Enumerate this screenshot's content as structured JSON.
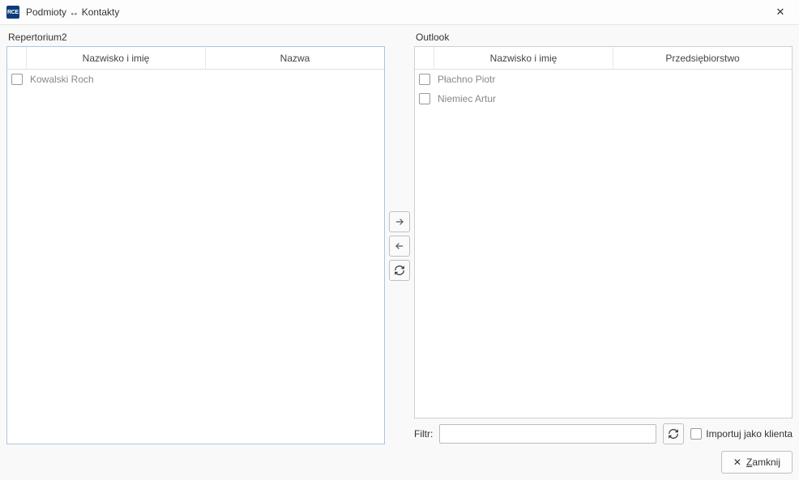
{
  "window": {
    "app_icon_text": "RCE",
    "title": "Podmioty ↔ Kontakty"
  },
  "left_panel": {
    "label": "Repertorium2",
    "columns": {
      "name": "Nazwisko i imię",
      "company": "Nazwa"
    },
    "rows": [
      {
        "name": "Kowalski Roch",
        "company": ""
      }
    ]
  },
  "right_panel": {
    "label": "Outlook",
    "columns": {
      "name": "Nazwisko i imię",
      "company": "Przedsiębiorstwo"
    },
    "rows": [
      {
        "name": "Płachno Piotr",
        "company": ""
      },
      {
        "name": "Niemiec Artur",
        "company": ""
      }
    ]
  },
  "filter": {
    "label": "Filtr:",
    "value": ""
  },
  "import_checkbox": {
    "label": "Importuj jako klienta"
  },
  "buttons": {
    "close_prefix": "Z",
    "close_rest": "amknij"
  }
}
